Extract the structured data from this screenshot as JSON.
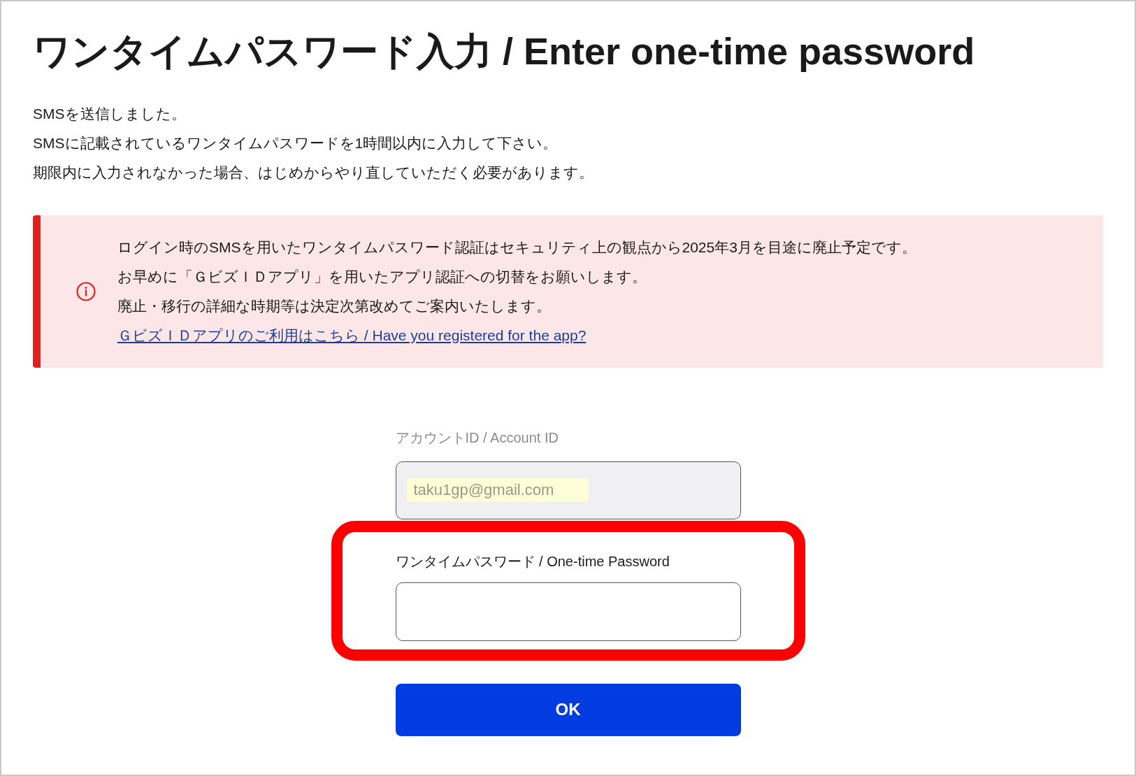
{
  "title": "ワンタイムパスワード入力 / Enter one-time password",
  "intro": [
    "SMSを送信しました。",
    "SMSに記載されているワンタイムパスワードを1時間以内に入力して下さい。",
    "期限内に入力されなかった場合、はじめからやり直していただく必要があります。"
  ],
  "notice": {
    "lines": [
      "ログイン時のSMSを用いたワンタイムパスワード認証はセキュリティ上の観点から2025年3月を目途に廃止予定です。",
      "お早めに「ＧビズＩＤアプリ」を用いたアプリ認証への切替をお願いします。",
      "廃止・移行の詳細な時期等は決定次第改めてご案内いたします。"
    ],
    "link": "ＧビズＩＤアプリのご利用はこちら / Have you registered for the app?"
  },
  "account_field": {
    "label": "アカウントID / Account ID",
    "value": "taku1gp@gmail.com",
    "disabled": true
  },
  "password_field": {
    "label": "ワンタイムパスワード / One-time Password",
    "highlighted": true
  },
  "submit_button": "OK"
}
